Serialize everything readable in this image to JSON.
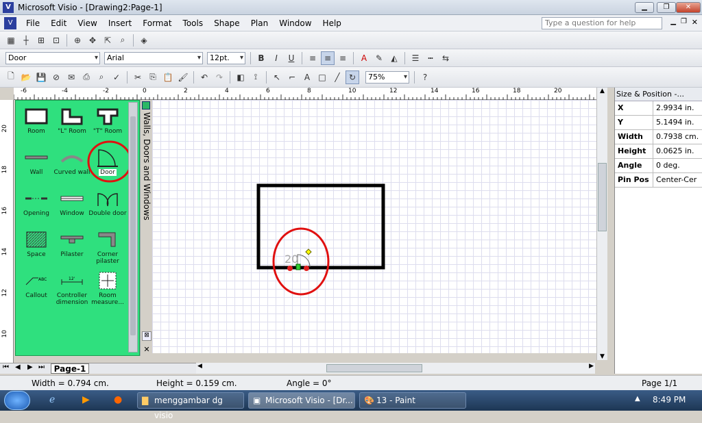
{
  "window": {
    "title": "Microsoft Visio - [Drawing2:Page-1]"
  },
  "menu": [
    "File",
    "Edit",
    "View",
    "Insert",
    "Format",
    "Tools",
    "Shape",
    "Plan",
    "Window",
    "Help"
  ],
  "help_placeholder": "Type a question for help",
  "format_toolbar": {
    "style": "Door",
    "font": "Arial",
    "size": "12pt."
  },
  "standard_toolbar": {
    "zoom": "75%"
  },
  "ruler_top_labels": [
    "-6",
    "-4",
    "-2",
    "0",
    "2",
    "4",
    "6",
    "8",
    "10",
    "12",
    "14",
    "16",
    "18",
    "20"
  ],
  "ruler_left_labels": [
    "20",
    "18",
    "16",
    "14",
    "12",
    "10"
  ],
  "stencil": {
    "title": "Walls, Doors and Windows",
    "shapes": [
      "Room",
      "\"L\" Room",
      "\"T\" Room",
      "Wall",
      "Curved wall",
      "Door",
      "Opening",
      "Window",
      "Double door",
      "Space",
      "Pilaster",
      "Corner pilaster",
      "Callout",
      "Controller dimension",
      "Room measure..."
    ],
    "callout_icon_text": "ABC",
    "controller_icon_text": "12'"
  },
  "canvas": {
    "door_label": "20"
  },
  "size_panel": {
    "title": "Size & Position -...",
    "rows": [
      {
        "k": "X",
        "v": "2.9934 in."
      },
      {
        "k": "Y",
        "v": "5.1494 in."
      },
      {
        "k": "Width",
        "v": "0.7938 cm."
      },
      {
        "k": "Height",
        "v": "0.0625 in."
      },
      {
        "k": "Angle",
        "v": "0 deg."
      },
      {
        "k": "Pin Pos",
        "v": "Center-Cer"
      }
    ]
  },
  "page_tab": "Page-1",
  "status": {
    "width": "Width = 0.794 cm.",
    "height": "Height = 0.159 cm.",
    "angle": "Angle = 0°",
    "page": "Page 1/1"
  },
  "taskbar": {
    "tasks": [
      "menggambar dg visio",
      "Microsoft Visio - [Dr...",
      "13 - Paint"
    ],
    "time": "8:49 PM"
  },
  "colors": {
    "stencil": "#2fe07e",
    "highlight": "#e01010",
    "accent": "#2b3f9e"
  }
}
